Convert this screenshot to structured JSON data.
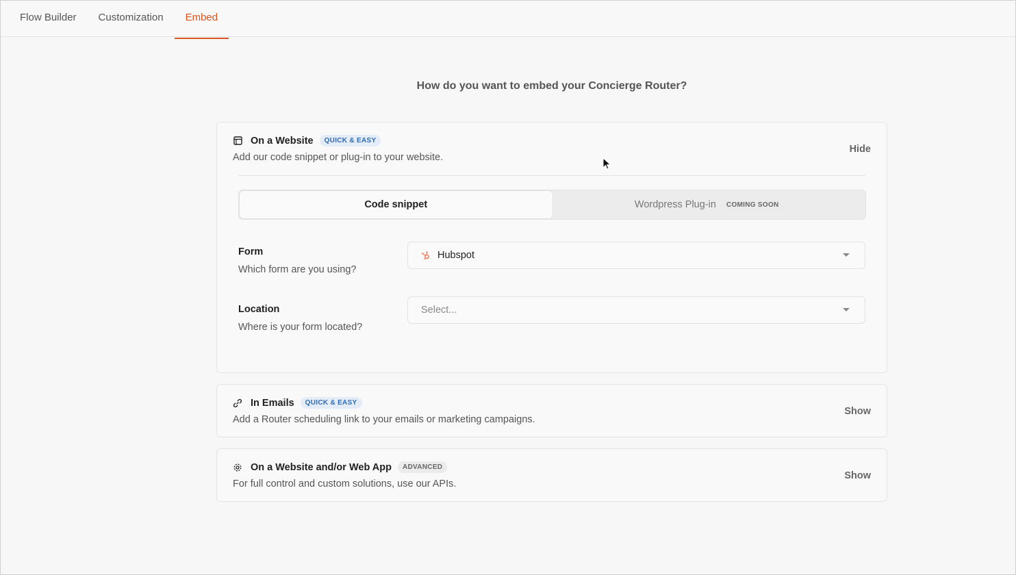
{
  "tabs": [
    {
      "label": "Flow Builder",
      "active": false
    },
    {
      "label": "Customization",
      "active": false
    },
    {
      "label": "Embed",
      "active": true
    }
  ],
  "heading": "How do you want to embed your Concierge Router?",
  "colors": {
    "accent": "#d9541e",
    "badge_blue": "#2f6bb5",
    "hubspot": "#ff7a59"
  },
  "website_card": {
    "icon": "browser-window-icon",
    "title": "On a Website",
    "badge": "QUICK & EASY",
    "subtitle": "Add our code snippet or plug-in to your website.",
    "toggle": "Hide",
    "segments": {
      "code_snippet": "Code snippet",
      "wordpress": "Wordpress Plug-in",
      "wordpress_badge": "COMING SOON"
    },
    "form_field": {
      "label": "Form",
      "help": "Which form are you using?",
      "value": "Hubspot",
      "icon": "hubspot-icon"
    },
    "location_field": {
      "label": "Location",
      "help": "Where is your form located?",
      "placeholder": "Select..."
    }
  },
  "emails_card": {
    "icon": "link-icon",
    "title": "In Emails",
    "badge": "QUICK & EASY",
    "subtitle": "Add a Router scheduling link to your emails or marketing campaigns.",
    "toggle": "Show"
  },
  "advanced_card": {
    "icon": "gear-icon",
    "title": "On a Website and/or Web App",
    "badge": "ADVANCED",
    "subtitle": "For full control and custom solutions, use our APIs.",
    "toggle": "Show"
  }
}
